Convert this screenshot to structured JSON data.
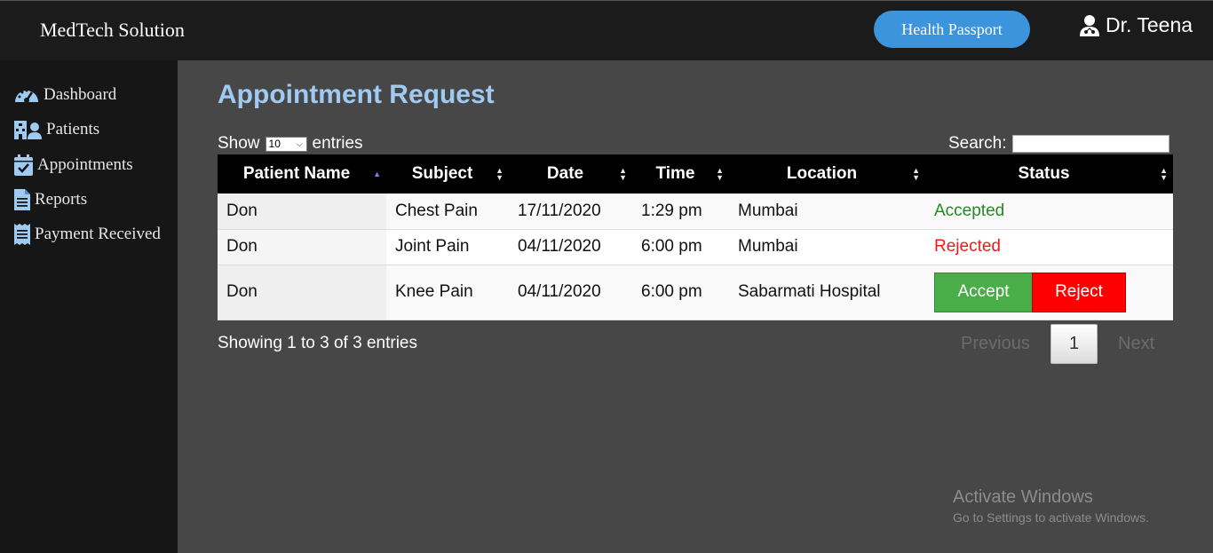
{
  "header": {
    "brand": "MedTech Solution",
    "passport_button": "Health Passport",
    "user_name": "Dr. Teena"
  },
  "sidebar": {
    "items": [
      {
        "label": "Dashboard",
        "icon": "dashboard-gauge-icon"
      },
      {
        "label": "Patients",
        "icon": "patients-hospital-icon"
      },
      {
        "label": "Appointments",
        "icon": "calendar-check-icon"
      },
      {
        "label": "Reports",
        "icon": "document-icon"
      },
      {
        "label": "Payment Received",
        "icon": "receipt-icon"
      }
    ]
  },
  "main": {
    "title": "Appointment Request",
    "show_label": "Show",
    "entries_value": "10",
    "entries_label": "entries",
    "search_label": "Search:",
    "search_value": "",
    "columns": [
      "Patient Name",
      "Subject",
      "Date",
      "Time",
      "Location",
      "Status"
    ],
    "rows": [
      {
        "patient": "Don",
        "subject": "Chest Pain",
        "date": "17/11/2020",
        "time": "1:29 pm",
        "location": "Mumbai",
        "status": "Accepted"
      },
      {
        "patient": "Don",
        "subject": "Joint Pain",
        "date": "04/11/2020",
        "time": "6:00 pm",
        "location": "Mumbai",
        "status": "Rejected"
      },
      {
        "patient": "Don",
        "subject": "Knee Pain",
        "date": "04/11/2020",
        "time": "6:00 pm",
        "location": "Sabarmati Hospital",
        "accept_label": "Accept",
        "reject_label": "Reject"
      }
    ],
    "info": "Showing 1 to 3 of 3 entries",
    "pagination": {
      "previous": "Previous",
      "current": "1",
      "next": "Next"
    }
  },
  "watermark": {
    "title": "Activate Windows",
    "subtitle": "Go to Settings to activate Windows."
  },
  "colors": {
    "accent": "#9fcbf2",
    "accepted": "#248a24",
    "rejected": "#f21818",
    "accept_button": "#49ad48",
    "reject_button": "#ff0000",
    "passport_button": "#3c95dc"
  }
}
